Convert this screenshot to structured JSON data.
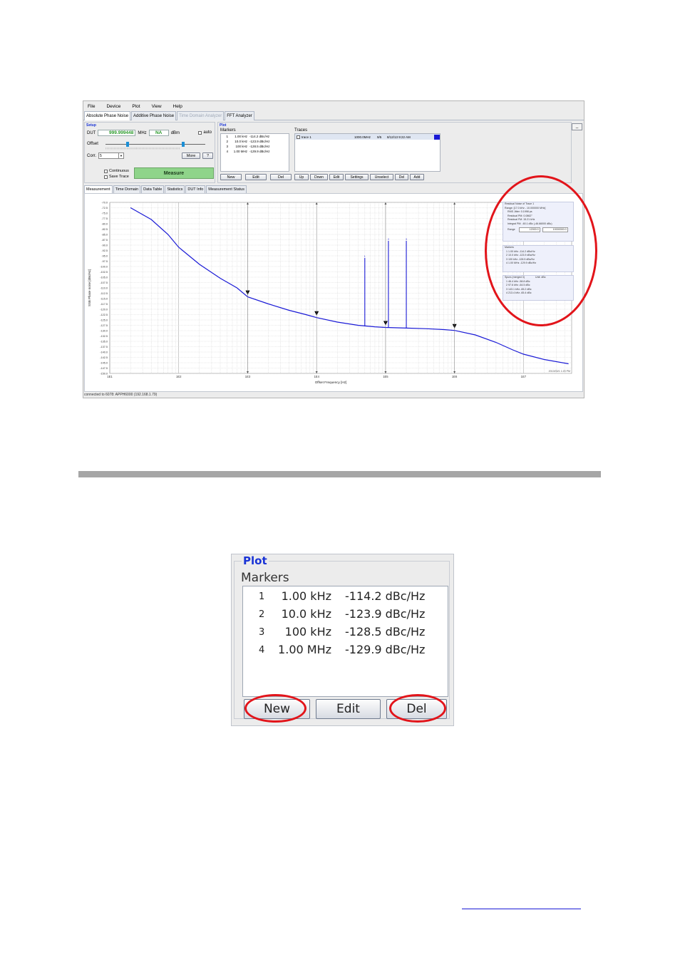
{
  "app": {
    "menu": [
      "File",
      "Device",
      "Plot",
      "View",
      "Help"
    ],
    "tabs": [
      "Absolute Phase Noise",
      "Additive Phase Noise",
      "Time Domain Analyzer",
      "FFT Analyzer"
    ],
    "minimize_label": "_",
    "setup": {
      "title": "Setup",
      "dut_label": "DUT",
      "dut_value": "999.999448",
      "dut_unit": "MHz",
      "power_value": "NA",
      "power_unit": "dBm",
      "auto_label": "auto",
      "offset_label": "Offset",
      "corr_label": "Corr.",
      "corr_value": "5",
      "more_label": "More",
      "help_label": "?",
      "continuous_label": "Continuous",
      "save_trace_label": "Save Trace",
      "measure_label": "Measure"
    },
    "plot": {
      "title": "Plot",
      "markers_label": "Markers",
      "markers": [
        {
          "num": "1",
          "freq": "1.00 kHz",
          "value": "-114.2 dBc/Hz"
        },
        {
          "num": "2",
          "freq": "10.0 kHz",
          "value": "-123.9 dBc/Hz"
        },
        {
          "num": "3",
          "freq": "100 kHz",
          "value": "-128.5 dBc/Hz"
        },
        {
          "num": "4",
          "freq": "1.00 MHz",
          "value": "-129.9 dBc/Hz"
        }
      ],
      "marker_buttons": {
        "new": "New",
        "edit": "Edit",
        "del": "Del"
      },
      "traces_label": "Traces",
      "trace": {
        "name": "trace 1",
        "freq": "1000.0MHz",
        "count": "9/5",
        "date": "8/12/13 9:22 AM",
        "color": "#1a1ad6"
      },
      "trace_buttons": {
        "up": "Up",
        "down": "Down",
        "edit": "Edit",
        "settings": "Settings",
        "unselect": "Unselect",
        "del": "Del",
        "add": "Add"
      }
    },
    "subtabs": [
      "Measurement",
      "Time Domain",
      "Data Table",
      "Statistics",
      "DUT Info",
      "Measurement Status"
    ],
    "status": "connected to 6078: APPH6000 (192.168.1.79)"
  },
  "chart_data": {
    "type": "line",
    "xlabel": "Offset Frequency [Hz]",
    "ylabel": "SSB Phase noise [dBc/Hz]",
    "x_scale": "log",
    "xlim": [
      10,
      50000000
    ],
    "ylim": [
      -150,
      -70
    ],
    "x_ticks": [
      "1E1",
      "1E2",
      "1E3",
      "1E4",
      "1E5",
      "1E6",
      "1E7"
    ],
    "y_ticks": [
      "-70.0",
      "-72.5",
      "-75.0",
      "-77.5",
      "-80.0",
      "-82.5",
      "-85.0",
      "-87.5",
      "-90.0",
      "-92.5",
      "-95.0",
      "-97.5",
      "-100.0",
      "-102.5",
      "-105.0",
      "-107.5",
      "-110.0",
      "-112.5",
      "-115.0",
      "-117.5",
      "-120.0",
      "-122.5",
      "-125.0",
      "-127.5",
      "-130.0",
      "-132.5",
      "-135.0",
      "-137.5",
      "-140.0",
      "-142.5",
      "-145.0",
      "-147.5",
      "-150.0"
    ],
    "series": [
      {
        "name": "trace 1",
        "color": "#1a1ad6",
        "x": [
          20,
          40,
          70,
          100,
          200,
          400,
          700,
          1000,
          2000,
          4000,
          7000,
          10000,
          20000,
          40000,
          70000,
          100000,
          200000,
          400000,
          700000,
          1000000,
          2000000,
          4000000,
          7000000,
          10000000,
          20000000,
          45000000
        ],
        "y": [
          -72.5,
          -78,
          -85,
          -91,
          -99,
          -105.5,
          -110,
          -114.2,
          -117.5,
          -120.5,
          -122.5,
          -123.9,
          -126,
          -127.5,
          -128.2,
          -128.5,
          -128.8,
          -129.1,
          -129.5,
          -129.9,
          -132,
          -135.5,
          -139,
          -141,
          -143.5,
          -145.5
        ]
      }
    ],
    "spurs": [
      {
        "label": "1",
        "x": 50000,
        "top": -96
      },
      {
        "label": "2",
        "x": 110000,
        "top": -88
      },
      {
        "label": "3",
        "x": 200000,
        "top": -88
      }
    ],
    "markers": [
      {
        "x": 1000,
        "y": -114.2
      },
      {
        "x": 10000,
        "y": -123.9
      },
      {
        "x": 100000,
        "y": -128.5
      },
      {
        "x": 1000000,
        "y": -129.9
      }
    ],
    "corner_date": "2013/03/1 1:20 PM",
    "grid": true
  },
  "side_panel": {
    "residual_title": "Residual Noise of Trace 1",
    "range_text": "Range: [17.0 kHz - 10.000000 MHz]",
    "rms_jitter": "RMS Jitter: 0.1998 ps",
    "residual_pm": "Residual PM: 0.0862°",
    "residual_fm": "Residual FM: 15.21 kHz",
    "integral_pm": "Integral PM: -60.1 dBc (-46.66000 dBc)",
    "range_label": "Range",
    "range_from": "12000.0",
    "range_to": "10000000.0",
    "markers_title": "Markers",
    "marker_lines": [
      "1   1.00 kHz   -114.2 dBc/Hz",
      "2   10.0 kHz   -123.9 dBc/Hz",
      "3   100 kHz   -128.5 dBc/Hz",
      "4   1.00 MHz   -129.9 dBc/Hz"
    ],
    "spurs_title": "Spurs (merged 3)",
    "spurs_unit": "Unit: dBc",
    "spur_lines": [
      "1   46.4 kHz   -58.8 dBc",
      "2   97.6 kHz   -64.5 dBc",
      "3   143.1 kHz   -65.2 dBc",
      "4   213.4 kHz   -65.4 dBc"
    ]
  },
  "zoom": {
    "title": "Plot",
    "markers_label": "Markers",
    "markers": [
      {
        "num": "1",
        "freq": "1.00 kHz",
        "value": "-114.2 dBc/Hz"
      },
      {
        "num": "2",
        "freq": "10.0 kHz",
        "value": "-123.9 dBc/Hz"
      },
      {
        "num": "3",
        "freq": "100 kHz",
        "value": "-128.5 dBc/Hz"
      },
      {
        "num": "4",
        "freq": "1.00 MHz",
        "value": "-129.9 dBc/Hz"
      }
    ],
    "buttons": {
      "new": "New",
      "edit": "Edit",
      "del": "Del"
    }
  },
  "colors": {
    "highlight": "#e2141a",
    "accent": "#1a34d6",
    "trace": "#1a1ad6",
    "measure": "#8fd48a"
  }
}
